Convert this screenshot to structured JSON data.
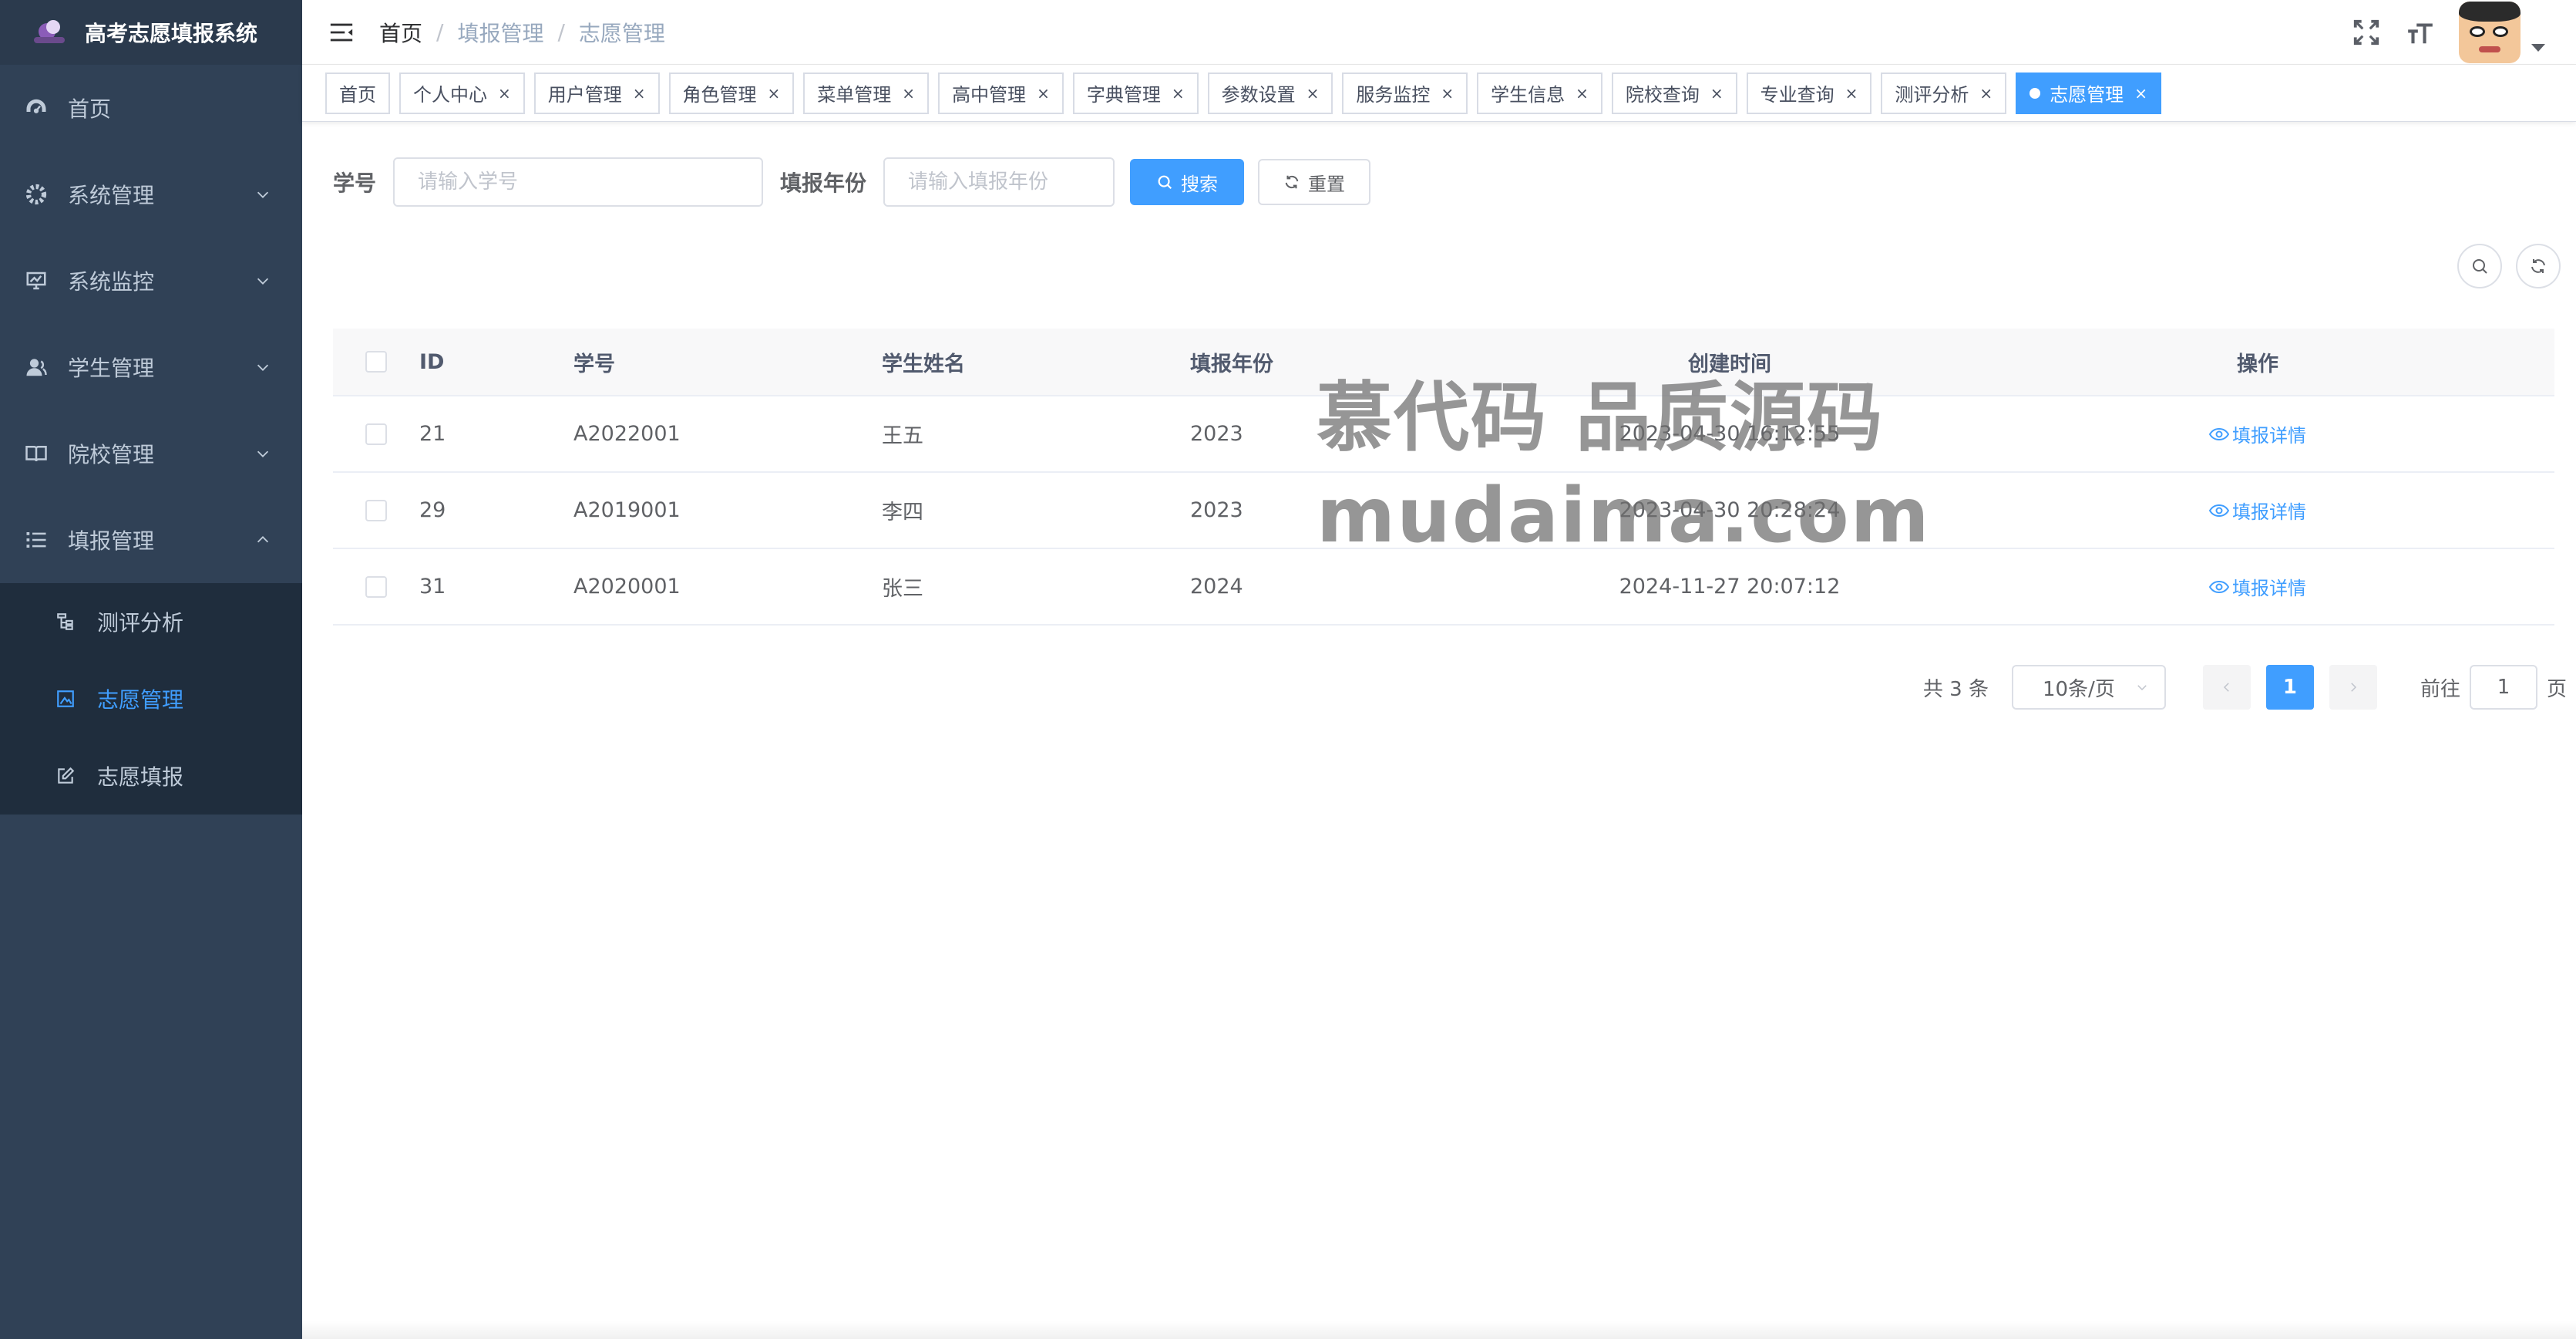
{
  "app": {
    "title": "高考志愿填报系统"
  },
  "sidebar": {
    "items": [
      {
        "label": "首页",
        "icon": "dashboard-icon"
      },
      {
        "label": "系统管理",
        "icon": "gear-icon"
      },
      {
        "label": "系统监控",
        "icon": "monitor-icon"
      },
      {
        "label": "学生管理",
        "icon": "user-icon"
      },
      {
        "label": "院校管理",
        "icon": "book-icon"
      },
      {
        "label": "填报管理",
        "icon": "list-icon",
        "expanded": true
      }
    ],
    "subitems": [
      {
        "label": "测评分析",
        "icon": "tree-icon"
      },
      {
        "label": "志愿管理",
        "icon": "image-icon",
        "active": true
      },
      {
        "label": "志愿填报",
        "icon": "edit-icon"
      }
    ]
  },
  "breadcrumb": [
    "首页",
    "填报管理",
    "志愿管理"
  ],
  "tags": [
    {
      "label": "首页",
      "closable": false
    },
    {
      "label": "个人中心",
      "closable": true
    },
    {
      "label": "用户管理",
      "closable": true
    },
    {
      "label": "角色管理",
      "closable": true
    },
    {
      "label": "菜单管理",
      "closable": true
    },
    {
      "label": "高中管理",
      "closable": true
    },
    {
      "label": "字典管理",
      "closable": true
    },
    {
      "label": "参数设置",
      "closable": true
    },
    {
      "label": "服务监控",
      "closable": true
    },
    {
      "label": "学生信息",
      "closable": true
    },
    {
      "label": "院校查询",
      "closable": true
    },
    {
      "label": "专业查询",
      "closable": true
    },
    {
      "label": "测评分析",
      "closable": true
    },
    {
      "label": "志愿管理",
      "closable": true,
      "active": true
    }
  ],
  "tag_close": "×",
  "search": {
    "student_no_label": "学号",
    "student_no_placeholder": "请输入学号",
    "year_label": "填报年份",
    "year_placeholder": "请输入填报年份",
    "search_button": "搜索",
    "reset_button": "重置"
  },
  "table": {
    "columns": [
      "ID",
      "学号",
      "学生姓名",
      "填报年份",
      "创建时间",
      "操作"
    ],
    "rows": [
      {
        "id": "21",
        "student_no": "A2022001",
        "name": "王五",
        "year": "2023",
        "created": "2023-04-30 16:12:55",
        "action": "填报详情"
      },
      {
        "id": "29",
        "student_no": "A2019001",
        "name": "李四",
        "year": "2023",
        "created": "2023-04-30 20:28:24",
        "action": "填报详情"
      },
      {
        "id": "31",
        "student_no": "A2020001",
        "name": "张三",
        "year": "2024",
        "created": "2024-11-27 20:07:12",
        "action": "填报详情"
      }
    ]
  },
  "pagination": {
    "total_text": "共 3 条",
    "page_size": "10条/页",
    "current_page": "1",
    "goto_prefix": "前往",
    "goto_value": "1",
    "goto_suffix": "页"
  },
  "watermark": {
    "line1": "慕代码 品质源码",
    "line2": "mudaima.com"
  },
  "colors": {
    "sidebar_bg": "#304156",
    "submenu_bg": "#1f2d3d",
    "accent": "#409eff",
    "text": "#606266"
  }
}
